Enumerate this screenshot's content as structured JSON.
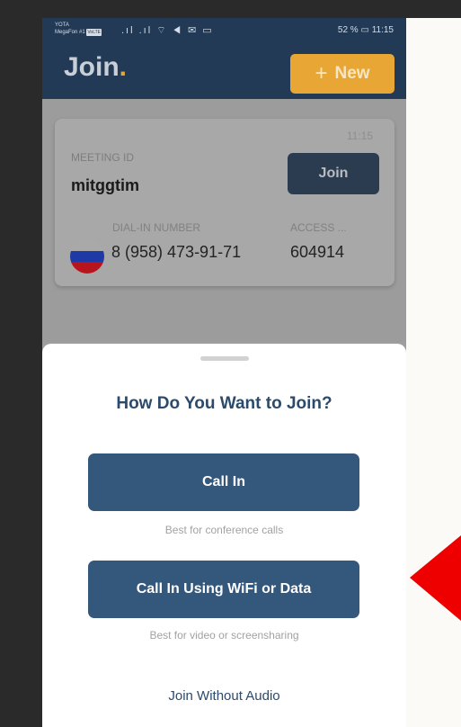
{
  "status_bar": {
    "carrier_1": "YOTA",
    "carrier_2": "MegaFon #1",
    "carrier_badge": "VoLTE",
    "icons_text": ".ıl .ıl ⌔ ◀ ✉ ▭",
    "battery": "52 %",
    "time": "11:15"
  },
  "header": {
    "logo_text": "Join",
    "logo_dot": ".",
    "new_button": {
      "icon": "plus-icon",
      "label": "New"
    }
  },
  "meeting_card": {
    "time": "11:15",
    "meeting_id_label": "MEETING ID",
    "meeting_id": "mitggtim",
    "join_label": "Join",
    "dial_in_label": "DIAL-IN NUMBER",
    "dial_in_number": "8 (958) 473-91-71",
    "access_label": "ACCESS ...",
    "access_code": "604914",
    "flag": "russia-flag"
  },
  "join_sheet": {
    "title": "How Do You Want to Join?",
    "call_in_label": "Call In",
    "call_in_hint": "Best for conference calls",
    "wifi_label": "Call In Using WiFi or Data",
    "wifi_hint": "Best for video or screensharing",
    "no_audio_label": "Join Without Audio"
  },
  "colors": {
    "brand_navy": "#223a56",
    "accent_orange": "#e8a735",
    "button_blue": "#34577c",
    "annotation_red": "#ee0000"
  }
}
